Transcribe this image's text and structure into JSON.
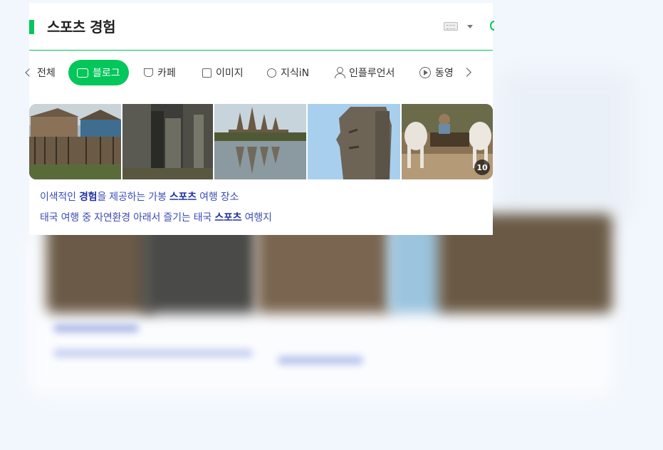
{
  "header": {
    "title": "스포츠 경험"
  },
  "tabs": [
    {
      "label": "전체",
      "icon": "all-icon",
      "active": false
    },
    {
      "label": "블로그",
      "icon": "blog-icon",
      "active": true
    },
    {
      "label": "카페",
      "icon": "cafe-icon",
      "active": false
    },
    {
      "label": "이미지",
      "icon": "image-icon",
      "active": false
    },
    {
      "label": "지식iN",
      "icon": "kin-icon",
      "active": false
    },
    {
      "label": "인플루언서",
      "icon": "person-icon",
      "active": false
    },
    {
      "label": "동영",
      "icon": "play-icon",
      "active": false
    }
  ],
  "images": {
    "count_badge": "10",
    "items": [
      {
        "alt": "stilt houses"
      },
      {
        "alt": "temple ruins"
      },
      {
        "alt": "angkor wat reflection"
      },
      {
        "alt": "stone face"
      },
      {
        "alt": "ox cart"
      }
    ]
  },
  "results": [
    {
      "segments": [
        "이색적인 ",
        "경험",
        "을 제공하는 가봉 ",
        "스포츠",
        " 여행 장소"
      ]
    },
    {
      "segments": [
        "태국 여행 중 자연환경 아래서 즐기는 태국 ",
        "스포츠",
        " 여행지"
      ]
    }
  ],
  "colors": {
    "accent": "#03c75a",
    "link": "#3a4db5",
    "background": "#f2f7fd"
  }
}
